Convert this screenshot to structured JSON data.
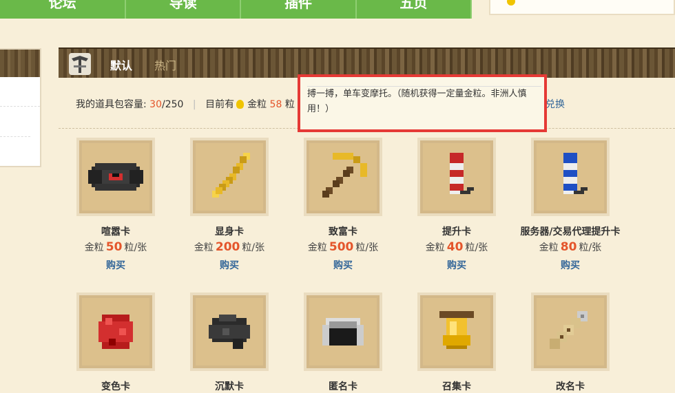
{
  "nav": {
    "items": [
      "论坛",
      "导读",
      "插件",
      "五页"
    ]
  },
  "header": {
    "tab_default": "默认",
    "tab_hot": "热门"
  },
  "info": {
    "capacity_label": "我的道具包容量:",
    "capacity_used": "30",
    "capacity_total": "/250",
    "current_label": "目前有",
    "gold_label": "金粒",
    "gold_amount": "58",
    "gold_unit": "粒",
    "exchange": "兑换"
  },
  "tooltip": {
    "text": "搏一搏，单车变摩托。（随机获得一定量金粒。非洲人慎用！）"
  },
  "items": [
    {
      "name": "喧嚣卡",
      "price_label": "金粒",
      "price": "50",
      "unit": "粒/张",
      "buy": "购买",
      "icon": "record-disc-icon"
    },
    {
      "name": "显身卡",
      "price_label": "金粒",
      "price": "200",
      "unit": "粒/张",
      "buy": "购买",
      "icon": "golden-arrow-icon"
    },
    {
      "name": "致富卡",
      "price_label": "金粒",
      "price": "500",
      "unit": "粒/张",
      "buy": "购买",
      "icon": "golden-pickaxe-icon"
    },
    {
      "name": "提升卡",
      "price_label": "金粒",
      "price": "40",
      "unit": "粒/张",
      "buy": "购买",
      "icon": "red-firework-icon"
    },
    {
      "name": "服务器/交易代理提升卡",
      "price_label": "金粒",
      "price": "80",
      "unit": "粒/张",
      "buy": "购买",
      "icon": "blue-firework-icon"
    },
    {
      "name": "变色卡",
      "icon": "redstone-dust-icon"
    },
    {
      "name": "沉默卡",
      "icon": "coal-dust-icon"
    },
    {
      "name": "匿名卡",
      "icon": "iron-helmet-icon"
    },
    {
      "name": "召集卡",
      "icon": "golden-bell-icon"
    },
    {
      "name": "改名卡",
      "icon": "name-tag-icon"
    }
  ],
  "colors": {
    "nav_green": "#6ab949",
    "price_red": "#e4552b",
    "link_blue": "#336699",
    "tooltip_border": "#e53935"
  }
}
